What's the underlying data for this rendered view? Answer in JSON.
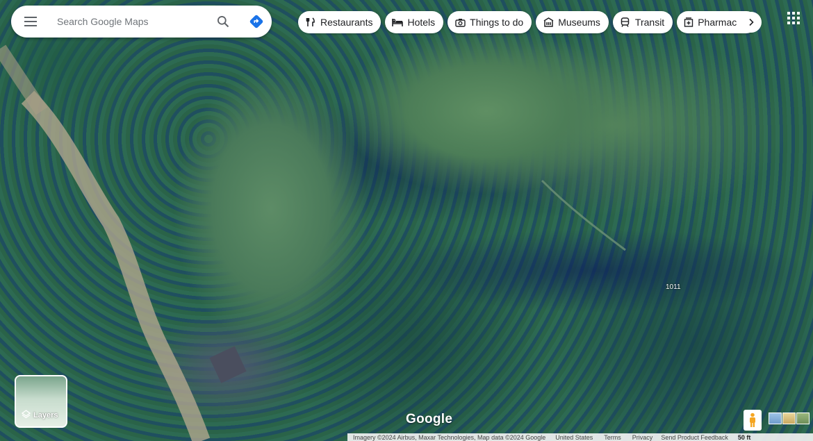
{
  "search": {
    "placeholder": "Search Google Maps"
  },
  "icons": {
    "menu": "hamburger-menu-icon",
    "search": "magnifier-icon",
    "directions": "directions-arrow-icon",
    "apps": "grid-icon"
  },
  "chips": [
    {
      "label": "Restaurants",
      "icon": "fork-knife-icon"
    },
    {
      "label": "Hotels",
      "icon": "bed-icon"
    },
    {
      "label": "Things to do",
      "icon": "camera-icon"
    },
    {
      "label": "Museums",
      "icon": "museum-icon"
    },
    {
      "label": "Transit",
      "icon": "train-icon"
    },
    {
      "label": "Pharmac",
      "icon": "pharmacy-icon"
    }
  ],
  "map": {
    "road_label": "1011"
  },
  "layers": {
    "label": "Layers"
  },
  "logo": "Google",
  "footer": {
    "imagery": "Imagery ©2024 Airbus, Maxar Technologies, Map data ©2024 Google",
    "country": "United States",
    "terms": "Terms",
    "privacy": "Privacy",
    "feedback": "Send Product Feedback",
    "scale": "50 ft"
  },
  "colors": {
    "accent": "#1a73e8",
    "chip_text": "#202124"
  }
}
